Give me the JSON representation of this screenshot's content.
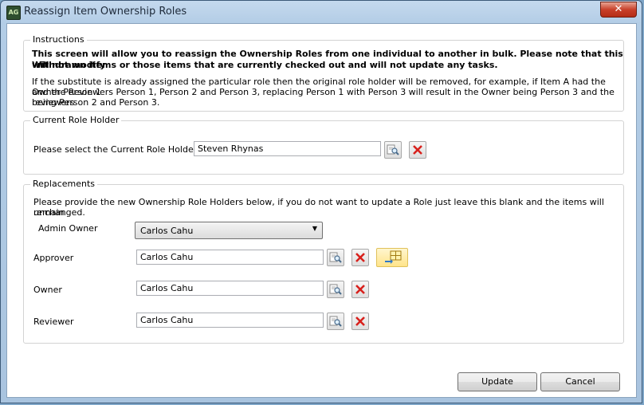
{
  "window": {
    "app_icon_text": "AG",
    "title": "Reassign Item Ownership Roles",
    "close_glyph": "✕"
  },
  "instructions": {
    "legend": "Instructions",
    "bold_lines": [
      "This screen will allow you to reassign the Ownership Roles from one individual to another in bulk. Please note that this will not modify",
      "Withdrawn items or those items that are currently checked out and will not update any tasks."
    ],
    "body_lines": [
      "If the substitute is already assigned the particular role then the original role holder will be removed, for example, if Item A had the Owner Person 1",
      "and the Reviewers Person 1, Person 2 and Person 3, replacing Person 1 with Person 3 will result in the Owner being Person 3 and the reviewers",
      "being Person 2 and Person 3."
    ]
  },
  "current_role_holder": {
    "legend": "Current Role Holder",
    "prompt": "Please select the Current Role Holder:",
    "value": "Steven Rhynas"
  },
  "replacements": {
    "legend": "Replacements",
    "description_lines": [
      "Please provide the new Ownership Role Holders below, if you do not want to update a Role just leave this blank and the items will remain",
      "unchanged."
    ],
    "admin_owner": {
      "label": "Admin Owner",
      "value": "Carlos Cahu"
    },
    "approver": {
      "label": "Approver",
      "value": "Carlos Cahu"
    },
    "owner": {
      "label": "Owner",
      "value": "Carlos Cahu"
    },
    "reviewer": {
      "label": "Reviewer",
      "value": "Carlos Cahu"
    }
  },
  "buttons": {
    "update": "Update",
    "cancel": "Cancel"
  },
  "icons": {
    "lookup": "magnifier-lookup-icon",
    "clear": "red-x-clear-icon",
    "apply_all": "apply-to-all-grid-icon"
  },
  "colors": {
    "clear_red": "#d8201c",
    "highlight_yellow": "#ffe48a"
  }
}
